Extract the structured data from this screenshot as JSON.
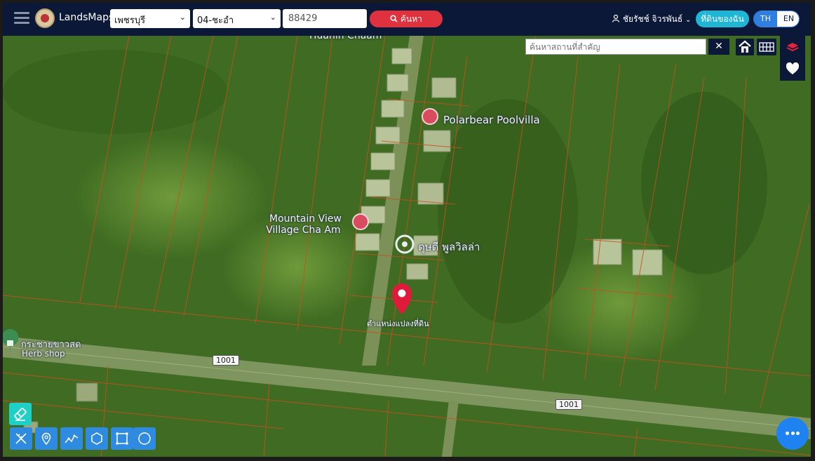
{
  "header": {
    "brand": "LandsMaps",
    "province_select": "เพชรบุรี",
    "district_select": "04-ชะอำ",
    "plot_number": "88429",
    "search_label": "ค้นหา",
    "user_name": "ชัยรัชช์ จิวรพันธ์",
    "my_land_label": "ที่ดินของฉัน",
    "lang_th": "TH",
    "lang_en": "EN"
  },
  "map_tools": {
    "place_search_placeholder": "ค้นหาสถานที่สำคัญ",
    "clear_symbol": "✕"
  },
  "map_labels": {
    "top_partial": "Huahin Chaam",
    "poi_polarbear": "Polarbear Poolvilla",
    "poi_mountain_line1": "Mountain View",
    "poi_mountain_line2": "Village Cha Am",
    "poi_pool_villa": "ดุษดี พูลวิลล่า",
    "marker_label": "ตำแหน่งแปลงที่ดิน",
    "herb_shop_th": "กระชายขาวสด",
    "herb_shop_en": "Herb shop",
    "road_badge_1": "1001",
    "road_badge_2": "1001"
  },
  "colors": {
    "header_bg": "#0b1838",
    "search_red": "#e0313e",
    "accent_cyan": "#1fb6d6",
    "accent_blue": "#2f7fe0",
    "parcel_line": "#c8501e",
    "marker_red": "#e01a3a"
  },
  "icons": [
    "menu-icon",
    "search-icon",
    "user-icon",
    "home-icon",
    "grid-icon",
    "layers-icon",
    "heart-icon",
    "eraser-icon",
    "ruler-icon",
    "pin-icon",
    "polyline-icon",
    "polygon-icon",
    "rectangle-icon",
    "circle-icon",
    "more-icon"
  ]
}
